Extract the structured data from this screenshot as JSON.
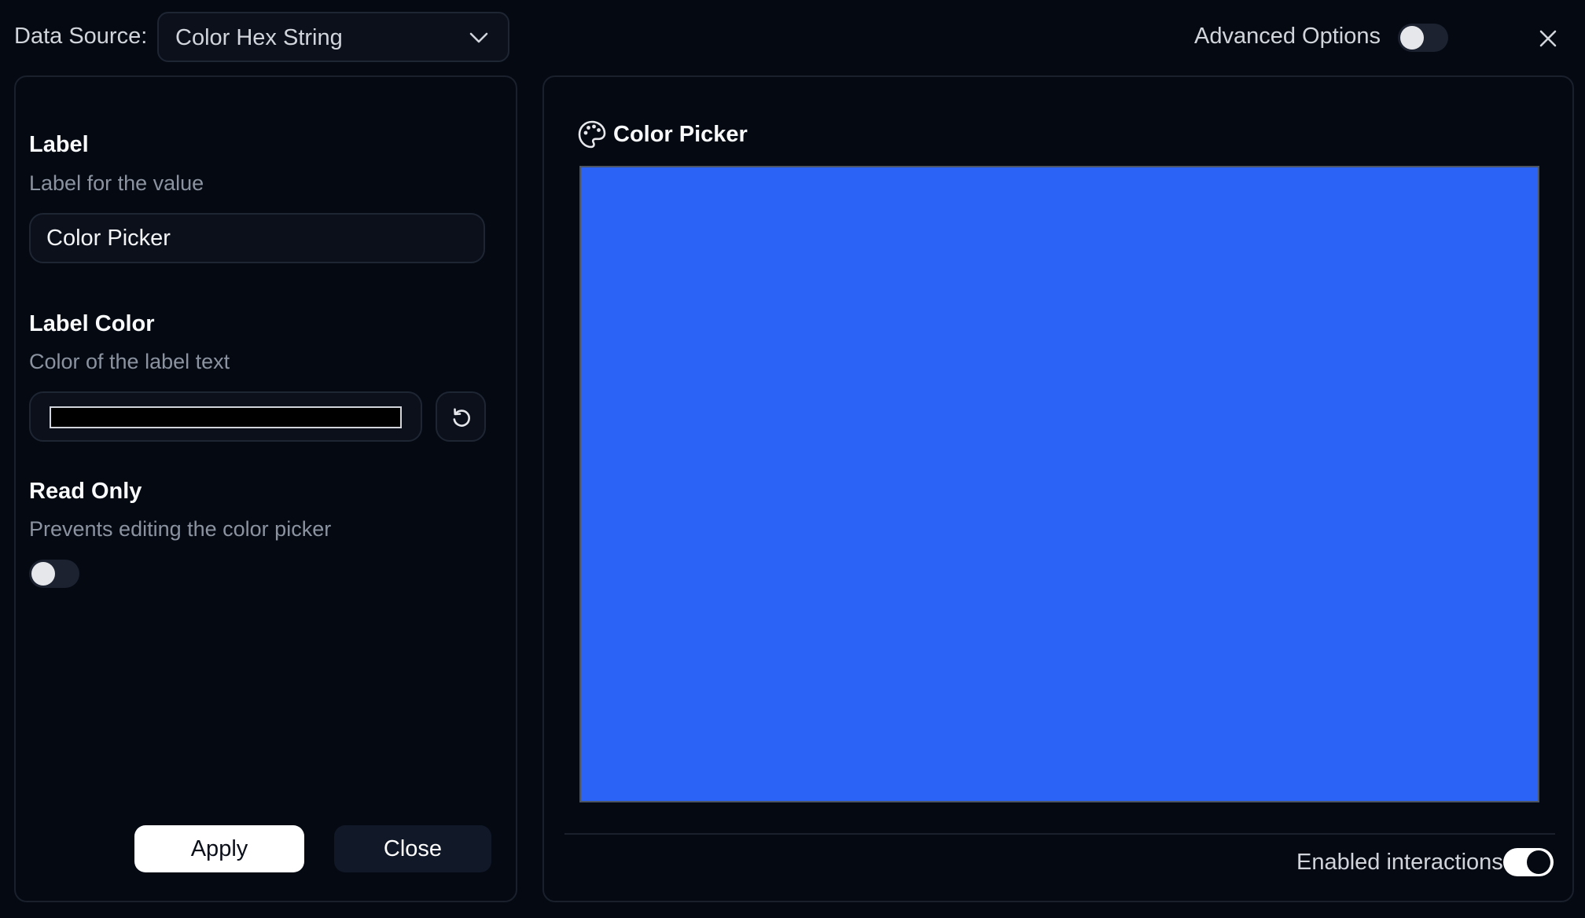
{
  "topbar": {
    "data_source_label": "Data Source:",
    "data_source_value": "Color Hex String",
    "advanced_options_label": "Advanced Options",
    "advanced_options_enabled": false
  },
  "settings": {
    "label_title": "Label",
    "label_description": "Label for the value",
    "label_value": "Color Picker",
    "label_color_title": "Label Color",
    "label_color_description": "Color of the label text",
    "label_color_value": "#000000",
    "read_only_title": "Read Only",
    "read_only_description": "Prevents editing the color picker",
    "read_only_enabled": false,
    "apply_label": "Apply",
    "close_label": "Close"
  },
  "preview": {
    "title": "Color Picker",
    "title_icon": "palette-icon",
    "color": "#2B63F6",
    "enabled_interactions_label": "Enabled interactions",
    "enabled_interactions": true
  },
  "icons": {
    "dropdown": "chevron-down-icon",
    "close": "close-icon",
    "reset": "reset-icon"
  }
}
